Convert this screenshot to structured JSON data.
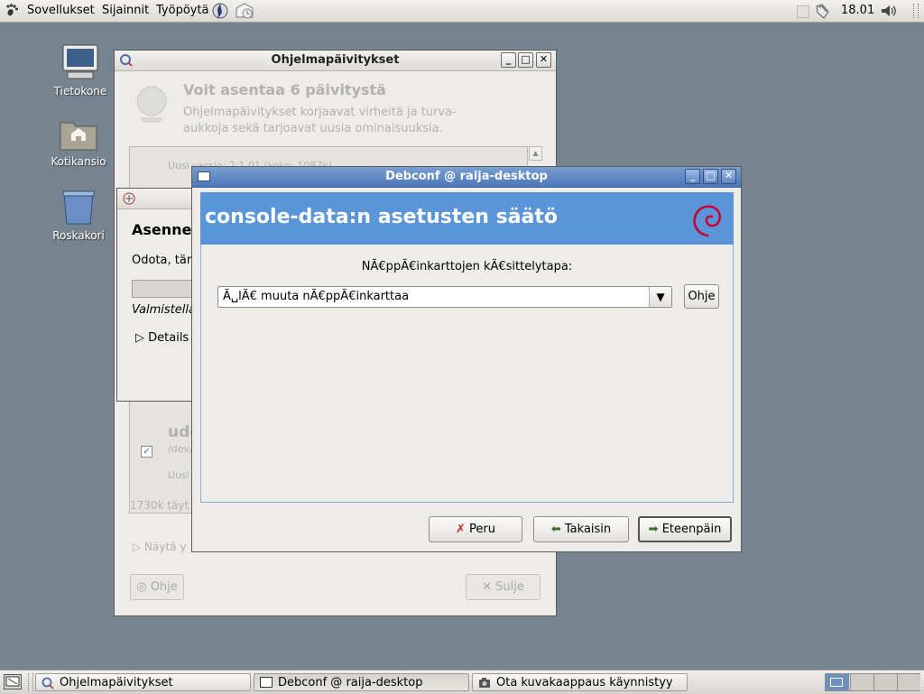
{
  "top_panel": {
    "menus": [
      "Sovellukset",
      "Sijainnit",
      "Työpöytä"
    ],
    "clock": "18.01"
  },
  "desktop": {
    "icons": [
      {
        "label": "Tietokone",
        "icon": "computer-icon"
      },
      {
        "label": "Kotikansio",
        "icon": "home-folder-icon"
      },
      {
        "label": "Roskakori",
        "icon": "trash-icon"
      }
    ]
  },
  "update_window": {
    "title": "Ohjelmapäivitykset",
    "heading": "Voit asentaa 6 päivitystä",
    "description": "Ohjelmapäivitykset korjaavat virheitä ja turva-\naukkoja sekä tarjoavat uusia ominaisuuksia.",
    "list_faded_top": "Uusi versio: 2:1.01 (koko: 1087k)",
    "list_item_name": "udev",
    "list_item_path": "/dev/",
    "list_item_new": "Uusi",
    "size_text": "1730k täyt",
    "show_details": "Näytä y",
    "help_label": "Ohje",
    "close_label": "Sulje"
  },
  "install_window": {
    "heading": "Asenne",
    "wait_text": "Odota, tän",
    "status": "Valmistella",
    "details_label": "Details"
  },
  "debconf_window": {
    "title": "Debconf @ raija-desktop",
    "banner_title": "console-data:n asetusten säätö",
    "question": "NÃ€ppÃ€inkarttojen kÃ€sittelytapa:",
    "combo_value": "Ã␣lÃ€ muuta nÃ€ppÃ€inkarttaa",
    "help_button": "Ohje",
    "cancel_button": "Peru",
    "back_button": "Takaisin",
    "forward_button": "Eteenpäin",
    "banner_color": "#5b95d9",
    "debian_color": "#c70036"
  },
  "taskbar": {
    "items": [
      {
        "label": "Ohjelmapäivitykset",
        "active": false
      },
      {
        "label": "Debconf @ raija-desktop",
        "active": true
      },
      {
        "label": "Ota kuvakaappaus käynnistyy",
        "active": false
      }
    ]
  }
}
